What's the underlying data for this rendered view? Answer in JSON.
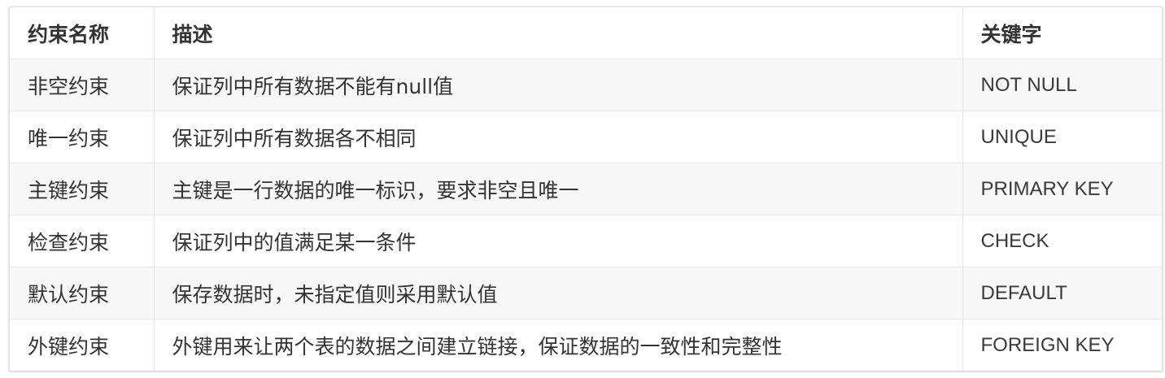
{
  "table": {
    "headers": [
      "约束名称",
      "描述",
      "关键字"
    ],
    "rows": [
      [
        "非空约束",
        "保证列中所有数据不能有null值",
        "NOT NULL"
      ],
      [
        "唯一约束",
        "保证列中所有数据各不相同",
        "UNIQUE"
      ],
      [
        "主键约束",
        "主键是一行数据的唯一标识，要求非空且唯一",
        "PRIMARY KEY"
      ],
      [
        "检查约束",
        "保证列中的值满足某一条件",
        "CHECK"
      ],
      [
        "默认约束",
        "保存数据时，未指定值则采用默认值",
        "DEFAULT"
      ],
      [
        "外键约束",
        "外键用来让两个表的数据之间建立链接，保证数据的一致性和完整性",
        "FOREIGN KEY"
      ]
    ]
  }
}
